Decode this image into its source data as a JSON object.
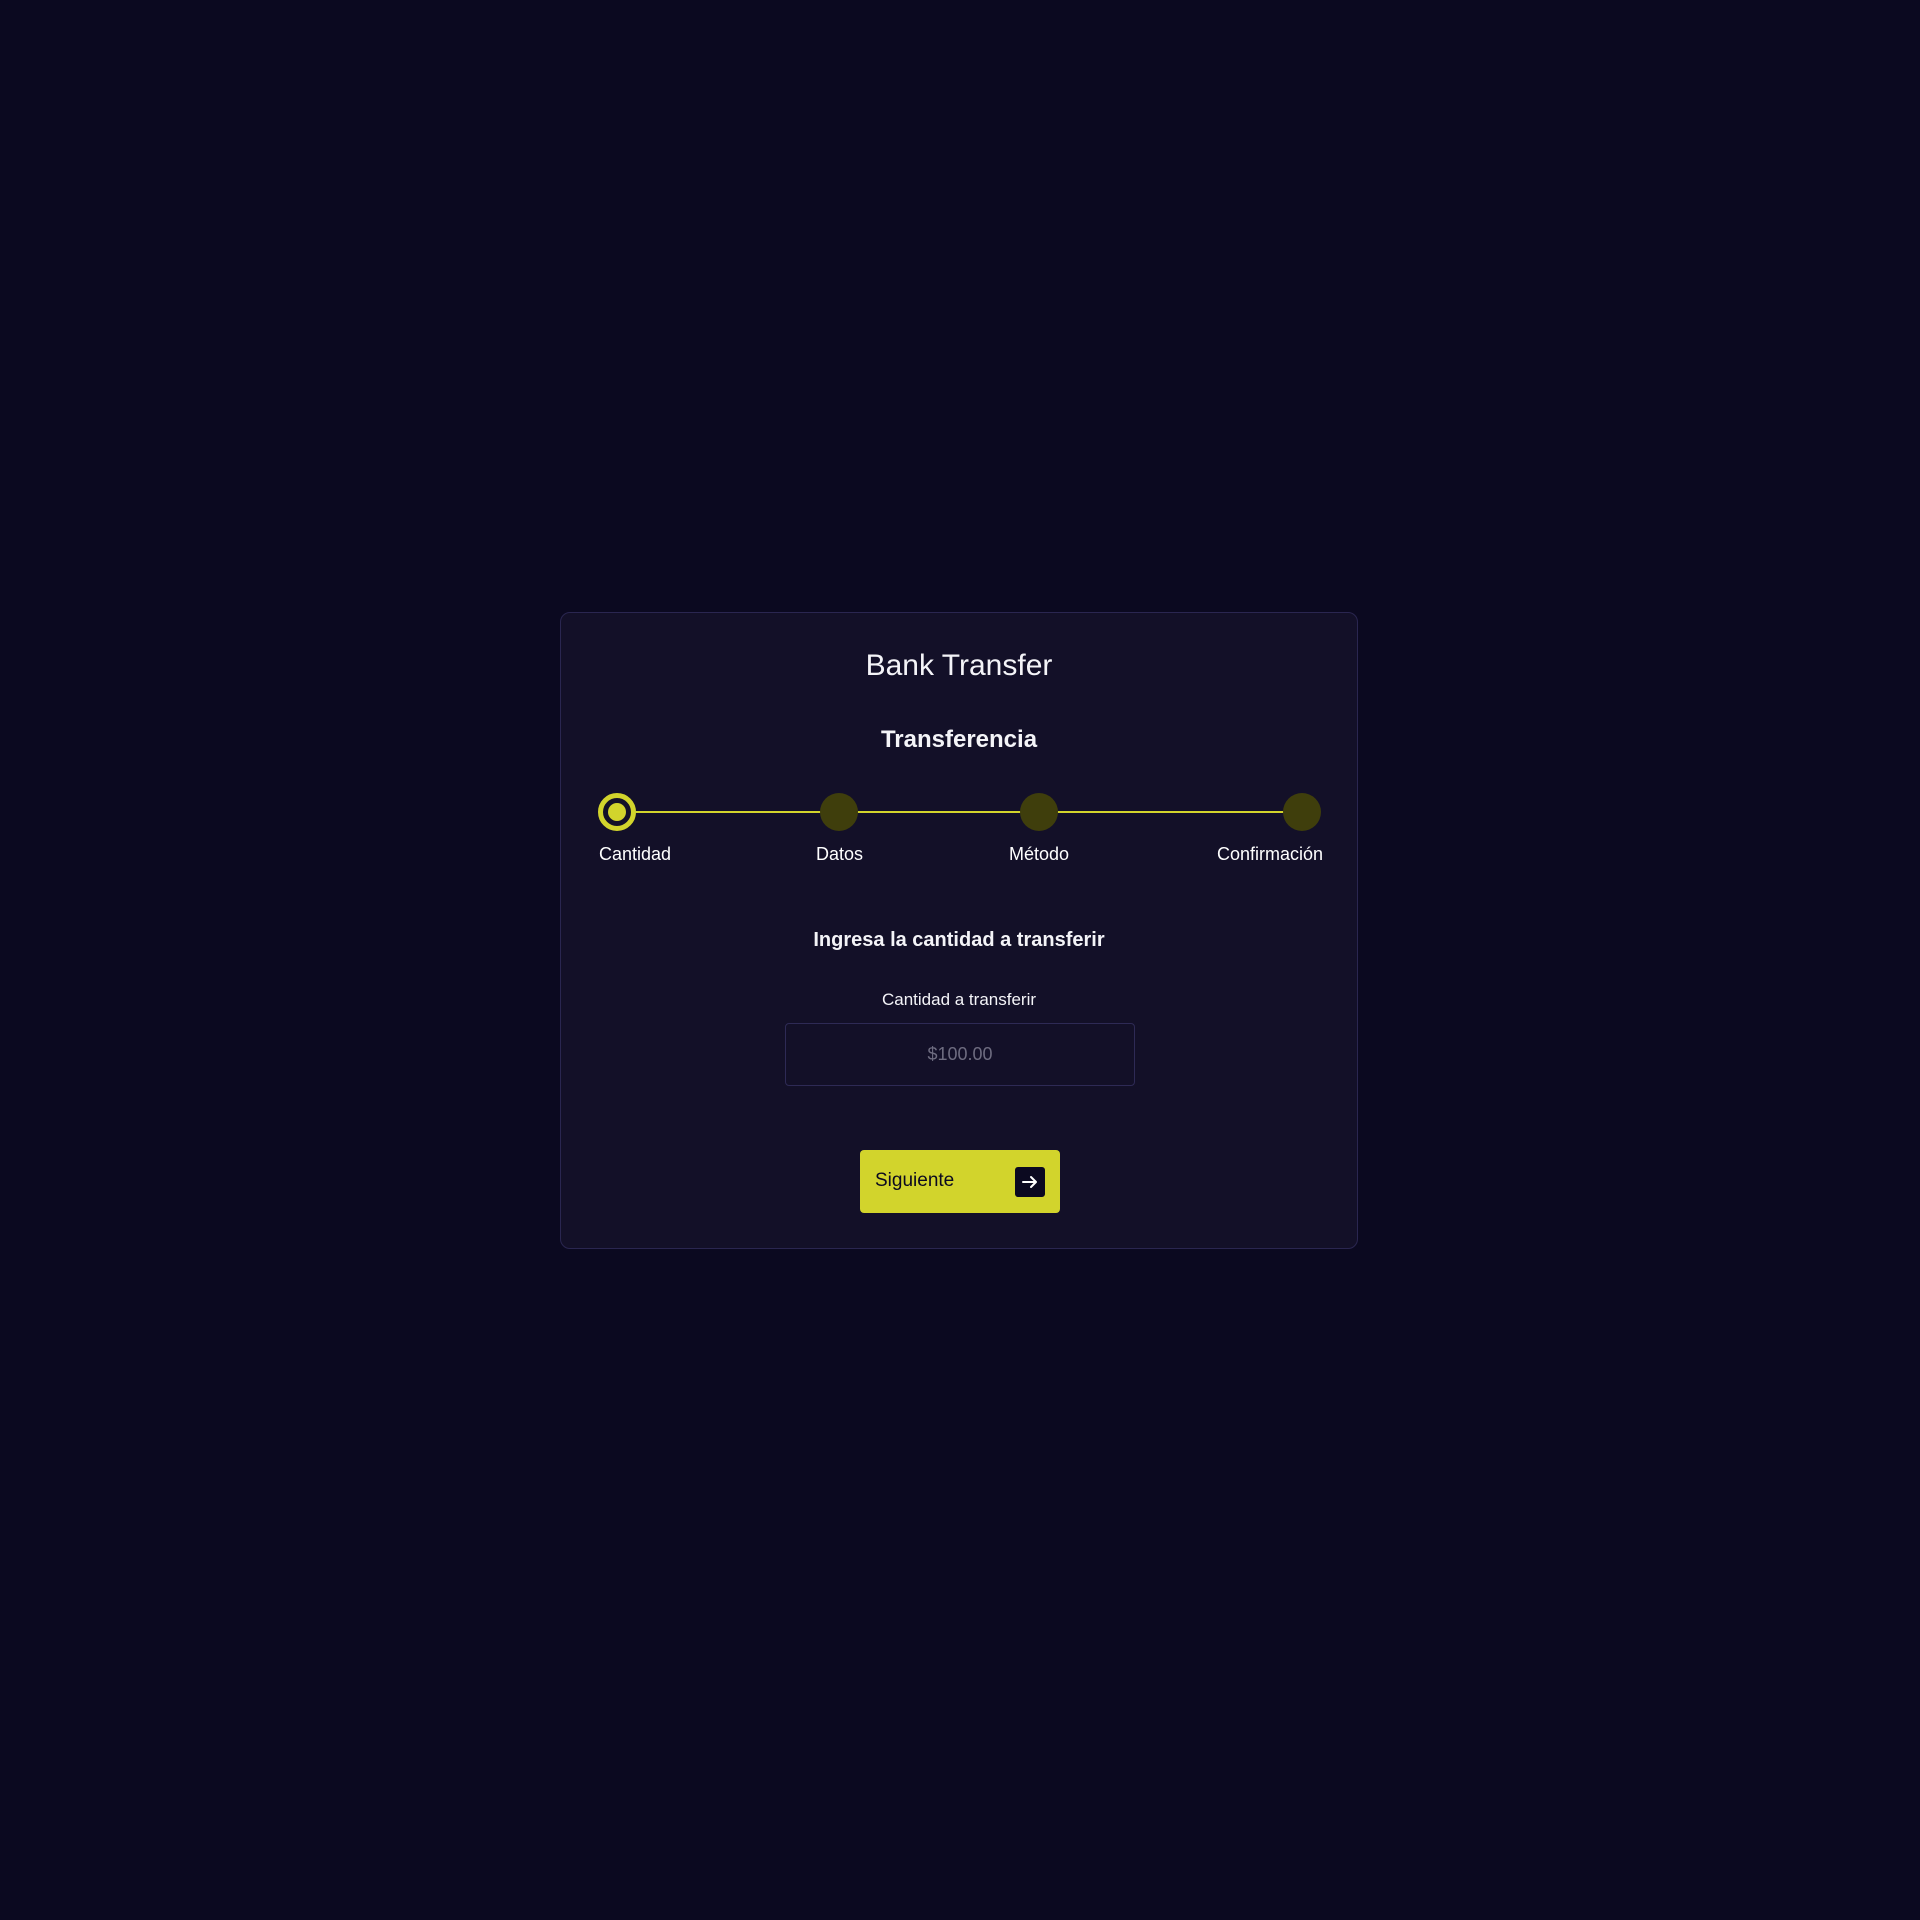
{
  "app": {
    "title": "Bank Transfer"
  },
  "section": {
    "title": "Transferencia"
  },
  "stepper": {
    "active_step": 1,
    "steps": [
      {
        "label": "Cantidad"
      },
      {
        "label": "Datos"
      },
      {
        "label": "Método"
      },
      {
        "label": "Confirmación"
      }
    ]
  },
  "form": {
    "prompt": "Ingresa la cantidad a transferir",
    "amount_label": "Cantidad a transferir",
    "amount_value": "",
    "amount_placeholder": "$100.00"
  },
  "actions": {
    "next_label": "Siguiente",
    "next_icon": "arrow-right-icon"
  },
  "colors": {
    "background": "#0b0920",
    "card": "#131028",
    "accent": "#d2d42c",
    "inactive_step": "#3f3e0c",
    "text": "#ffffff"
  }
}
